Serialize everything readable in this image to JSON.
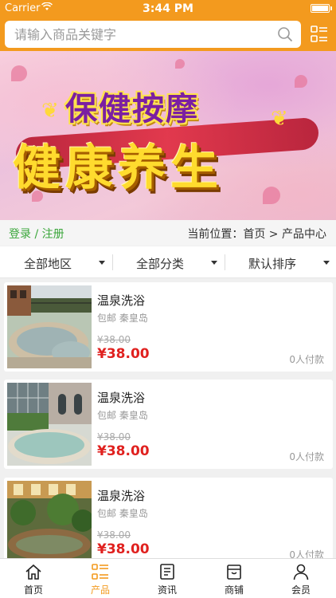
{
  "status_bar": {
    "carrier": "Carrier",
    "time": "3:44 PM"
  },
  "search": {
    "placeholder": "请输入商品关键字"
  },
  "banner": {
    "line1": "保健按摩",
    "line2": "健康养生"
  },
  "crumbs": {
    "login": "登录 / 注册",
    "location": "当前位置：首页 > 产品中心"
  },
  "filters": [
    {
      "label": "全部地区"
    },
    {
      "label": "全部分类"
    },
    {
      "label": "默认排序"
    }
  ],
  "products": [
    {
      "title": "温泉洗浴",
      "meta": "包邮 秦皇岛",
      "old_price": "¥38.00",
      "price": "¥38.00",
      "sold": "0人付款"
    },
    {
      "title": "温泉洗浴",
      "meta": "包邮 秦皇岛",
      "old_price": "¥38.00",
      "price": "¥38.00",
      "sold": "0人付款"
    },
    {
      "title": "温泉洗浴",
      "meta": "包邮 秦皇岛",
      "old_price": "¥38.00",
      "price": "¥38.00",
      "sold": "0人付款"
    }
  ],
  "tabs": [
    {
      "label": "首页",
      "icon": "home-icon"
    },
    {
      "label": "产品",
      "icon": "list-icon",
      "active": true
    },
    {
      "label": "资讯",
      "icon": "news-icon"
    },
    {
      "label": "商铺",
      "icon": "shop-icon"
    },
    {
      "label": "会员",
      "icon": "user-icon"
    }
  ],
  "colors": {
    "accent": "#f39a1e",
    "price": "#e0211f",
    "login": "#3aa63a"
  }
}
